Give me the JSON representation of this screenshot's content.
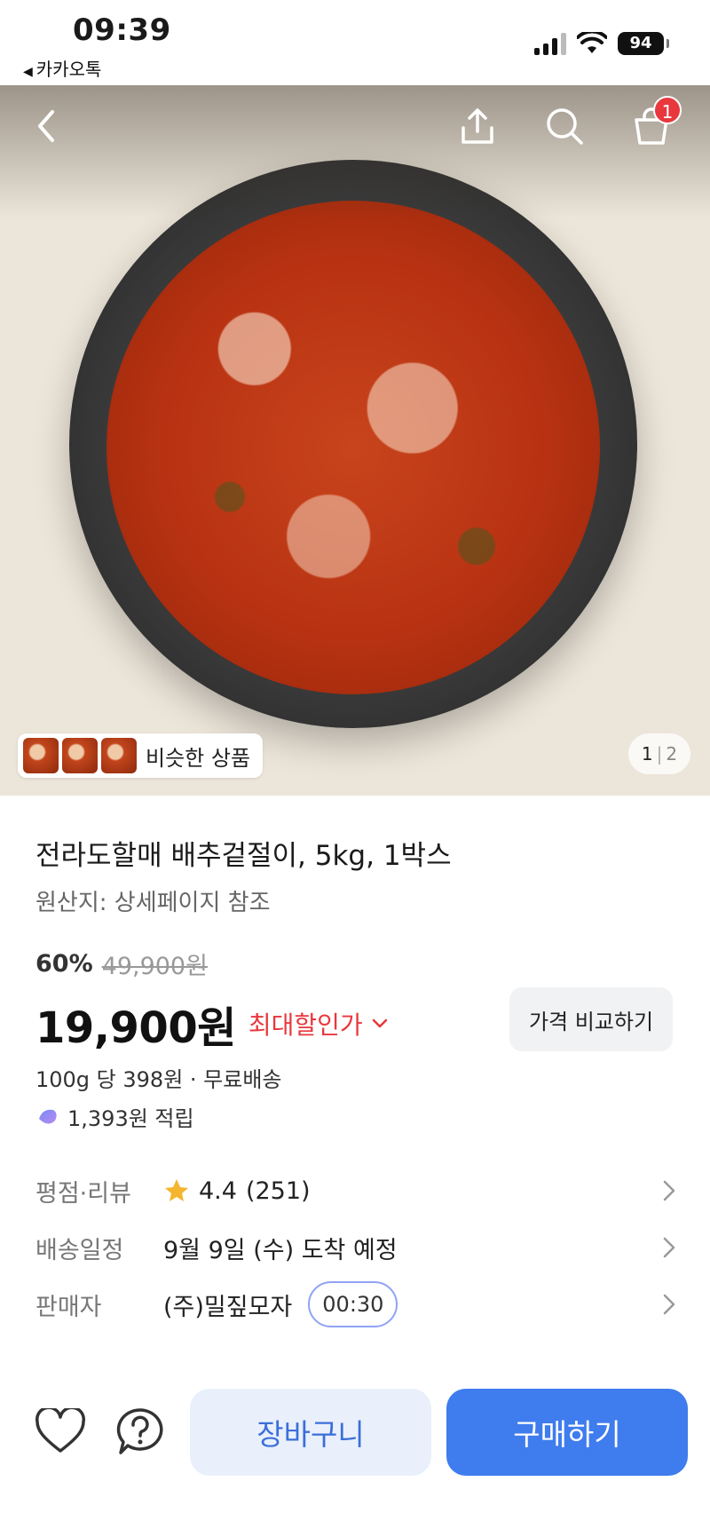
{
  "status_bar": {
    "time": "09:39",
    "back_app": "카카오톡",
    "battery": "94"
  },
  "hero": {
    "cart_count": "1",
    "similar_label": "비슷한 상품",
    "pager_current": "1",
    "pager_total": "2"
  },
  "product": {
    "title": "전라도할매 배추겉절이, 5kg, 1박스",
    "origin": "원산지: 상세페이지 참조",
    "discount_rate": "60%",
    "original_price": "49,900원",
    "price": "19,900원",
    "max_discount": "최대할인가",
    "compare_button": "가격 비교하기",
    "unit_price": "100g 당 398원 · 무료배송",
    "points": "1,393원 적립"
  },
  "info": {
    "rating_key": "평점·리뷰",
    "rating": "4.4",
    "reviews": "(251)",
    "delivery_key": "배송일정",
    "delivery_value": "9월 9일 (수) 도착 예정",
    "seller_key": "판매자",
    "seller_value": "(주)밀짚모자",
    "timer": "00:30"
  },
  "bottom": {
    "cart_button": "장바구니",
    "buy_button": "구매하기"
  },
  "colors": {
    "accent_blue": "#3f7cee",
    "discount_red": "#e8383d",
    "star": "#f5b52e"
  }
}
